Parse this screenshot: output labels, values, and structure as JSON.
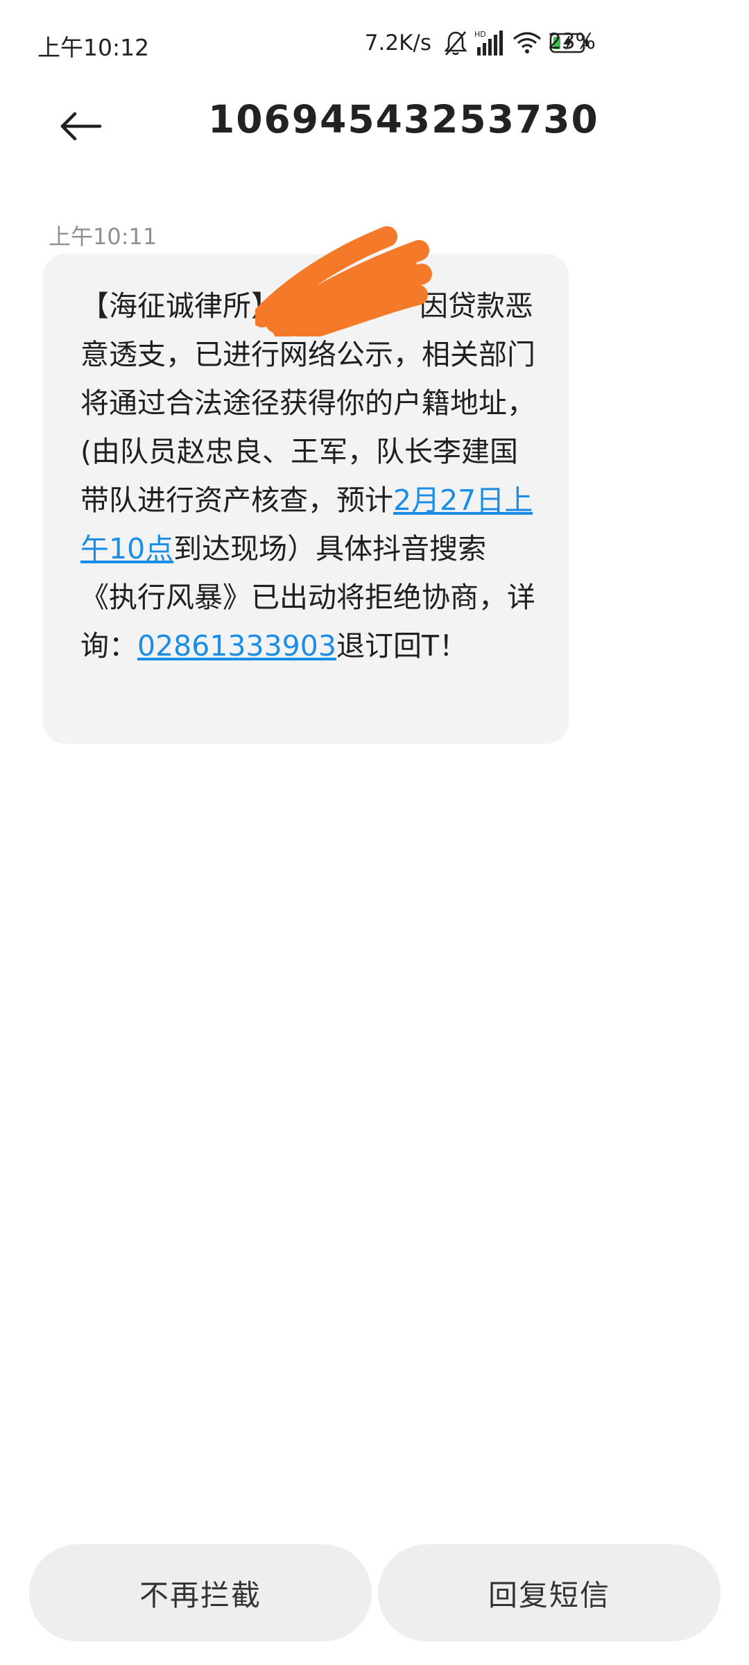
{
  "status_bar": {
    "time": "上午10:12",
    "net_speed": "7.2K/s",
    "battery_percent": "23%",
    "icons": [
      "bell-off-icon",
      "hd-signal-icon",
      "wifi-icon",
      "battery-charging-icon"
    ]
  },
  "header": {
    "title": "10694543253730",
    "back_icon": "arrow-left-icon"
  },
  "message": {
    "timestamp": "上午10:11",
    "text_part1": "【海征诚律所】",
    "text_part2": "因贷款恶意透支，已进行网络公示，相关部门将通过合法途径获得你的户籍地址，(由队员赵忠良、王军，队长李建国带队进行资产核查，预计",
    "date_link": "2月27日上午10点",
    "text_part3": "到达现场）具体抖音搜索《执行风暴》已出动将拒绝协商，详询：",
    "phone_link": "02861333903",
    "text_part4": "退订回T！"
  },
  "actions": {
    "block_label": "不再拦截",
    "reply_label": "回复短信"
  },
  "colors": {
    "link": "#1a8ee6",
    "bubble": "#f3f3f3",
    "redaction": "#f47a2a"
  }
}
